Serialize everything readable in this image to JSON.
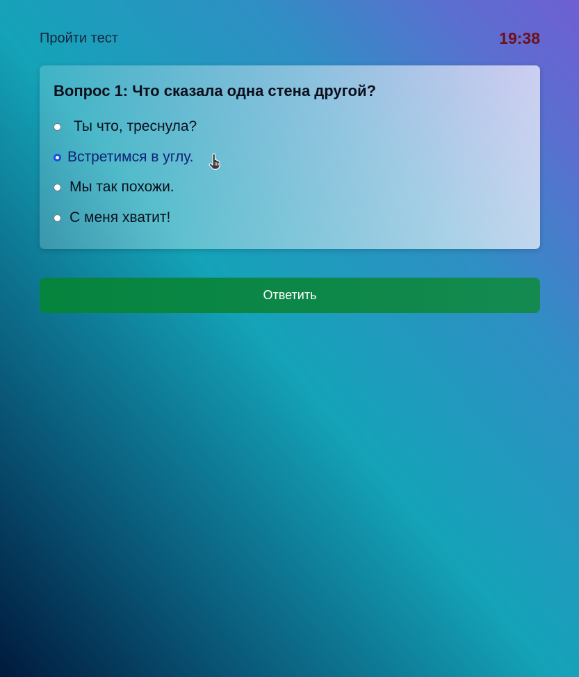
{
  "header": {
    "title": "Пройти тест",
    "timer": "19:38"
  },
  "question": {
    "title": "Вопрос 1: Что сказала одна стена другой?",
    "options": [
      {
        "label": "Ты что, треснула?",
        "selected": false
      },
      {
        "label": "Встретимся в углу.",
        "selected": true
      },
      {
        "label": "Мы так похожи.",
        "selected": false
      },
      {
        "label": "С меня хватит!",
        "selected": false
      }
    ]
  },
  "actions": {
    "submit_label": "Ответить"
  },
  "colors": {
    "timer": "#6e0f1a",
    "submit_button": "#05843e",
    "selected_radio": "#1c4fe0",
    "selected_text": "#0f1f78"
  },
  "icons": {
    "cursor": "hand-pointer-icon"
  }
}
